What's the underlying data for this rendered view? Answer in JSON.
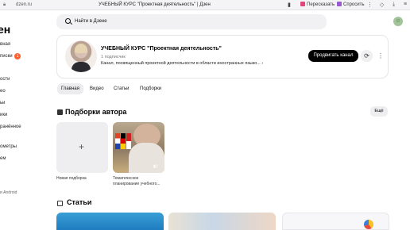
{
  "browser": {
    "url": "dzen.ru",
    "title": "УЧЕБНЫЙ КУРС \"Проектная деятельность\" | Дзен",
    "btn_retell": "Пересказать",
    "btn_ask": "Спросить"
  },
  "sidebar": {
    "logo": "ен",
    "items": [
      "вная",
      "писки",
      "ости",
      "ео",
      "ьи",
      "ики",
      "ранённое",
      "ометры",
      "ем",
      "и Android"
    ],
    "badge": "1"
  },
  "search": {
    "placeholder": "Найти в Дзене"
  },
  "channel": {
    "title": "УЧЕБНЫЙ КУРС \"Проектная деятельность\"",
    "subscribers": "1 подписчик",
    "description": "Канал, посвященный проектной деятельности в области иностранных языко...",
    "subscribe_label": "Продвигать канал"
  },
  "tabs": [
    "Главная",
    "Видео",
    "Статьи",
    "Подборки"
  ],
  "collections": {
    "title": "Подборки автора",
    "all_label": "Ещё",
    "new_label": "Новая подборка",
    "item1_line1": "Тематическое",
    "item1_line2": "планирование учебного..."
  },
  "articles": {
    "title": "Статьи"
  },
  "colors": {
    "accent": "#000000",
    "badge": "#ff5f2e",
    "tab_active": "#ececef"
  }
}
